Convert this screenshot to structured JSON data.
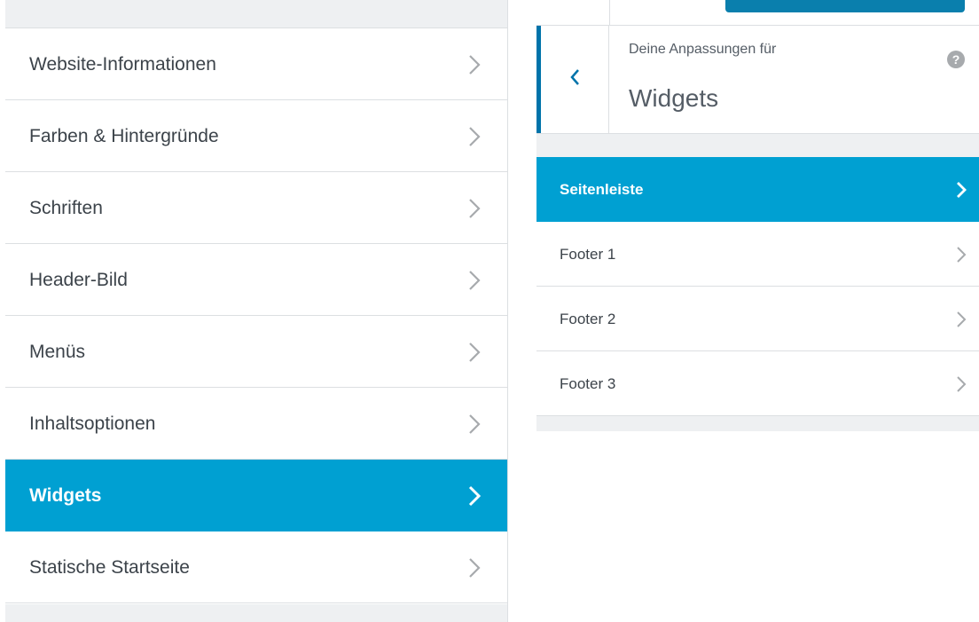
{
  "left_menu": {
    "items": [
      {
        "label": "Website-Informationen",
        "active": false
      },
      {
        "label": "Farben & Hintergründe",
        "active": false
      },
      {
        "label": "Schriften",
        "active": false
      },
      {
        "label": "Header-Bild",
        "active": false
      },
      {
        "label": "Menüs",
        "active": false
      },
      {
        "label": "Inhaltsoptionen",
        "active": false
      },
      {
        "label": "Widgets",
        "active": true
      },
      {
        "label": "Statische Startseite",
        "active": false
      }
    ]
  },
  "section": {
    "subtitle": "Deine Anpassungen für",
    "title": "Widgets",
    "back_icon": "chevron-left-icon",
    "help_icon": "help-icon",
    "help_glyph": "?"
  },
  "widget_areas": {
    "items": [
      {
        "label": "Seitenleiste",
        "active": true
      },
      {
        "label": "Footer 1",
        "active": false
      },
      {
        "label": "Footer 2",
        "active": false
      },
      {
        "label": "Footer 3",
        "active": false
      }
    ]
  },
  "colors": {
    "accent": "#00a0d2",
    "back_border": "#0073aa",
    "publish_button": "#0a7fad",
    "chevron_inactive": "#a7aaad",
    "chevron_active": "#ffffff"
  }
}
